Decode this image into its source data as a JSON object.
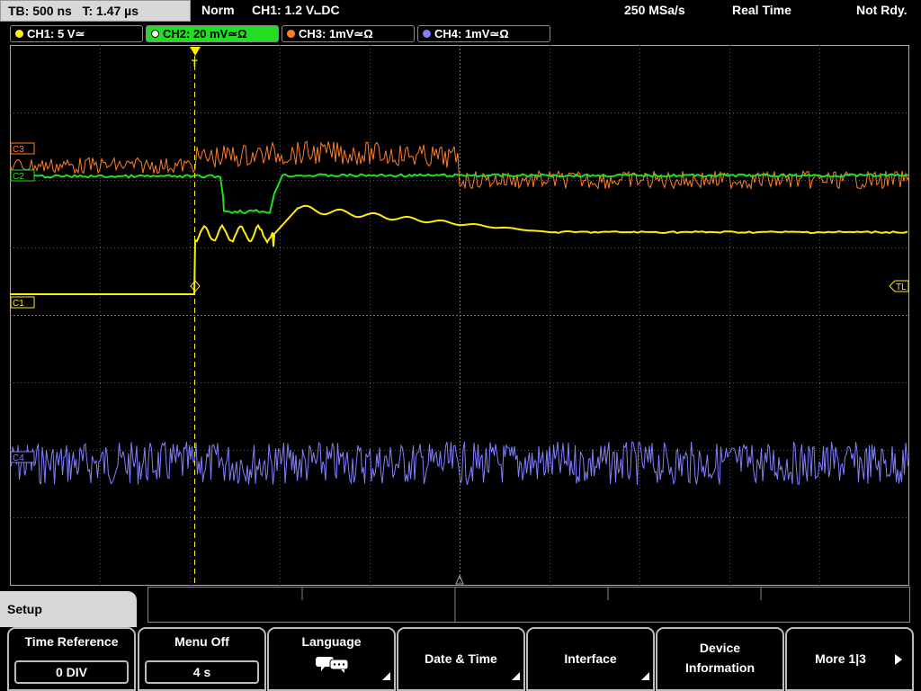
{
  "status": {
    "timebase": "TB: 500 ns",
    "trigger_time": "T: 1.47 µs",
    "trigger_mode": "Norm",
    "trigger_source": "CH1: 1.2 V",
    "trigger_coupling": "⨽DC",
    "sample_rate": "250 MSa/s",
    "acquisition": "Real Time",
    "ready": "Not Rdy."
  },
  "channels": [
    {
      "label": "CH1: 5 V≃",
      "color": "#ffee00"
    },
    {
      "label": "CH2: 20 mV≃Ω",
      "color": "#22dd22"
    },
    {
      "label": "CH3: 1mV≃Ω",
      "color": "#ff7f27"
    },
    {
      "label": "CH4: 1mV≃Ω",
      "color": "#8080ff"
    }
  ],
  "markers": {
    "c3": "C3",
    "c2": "C2",
    "c1": "C1",
    "c4": "C4",
    "trigger_level": "TL",
    "trigger_pos": "T"
  },
  "menu": {
    "title": "Setup",
    "time_reference": {
      "label": "Time Reference",
      "value": "0 DIV"
    },
    "menu_off": {
      "label": "Menu Off",
      "value": "4 s"
    },
    "language": {
      "label": "Language",
      "icon": "speech-bubbles-icon"
    },
    "date_time": {
      "label": "Date & Time"
    },
    "interface": {
      "label": "Interface"
    },
    "device_info": {
      "label1": "Device",
      "label2": "Information"
    },
    "more": {
      "label": "More 1|3"
    }
  }
}
